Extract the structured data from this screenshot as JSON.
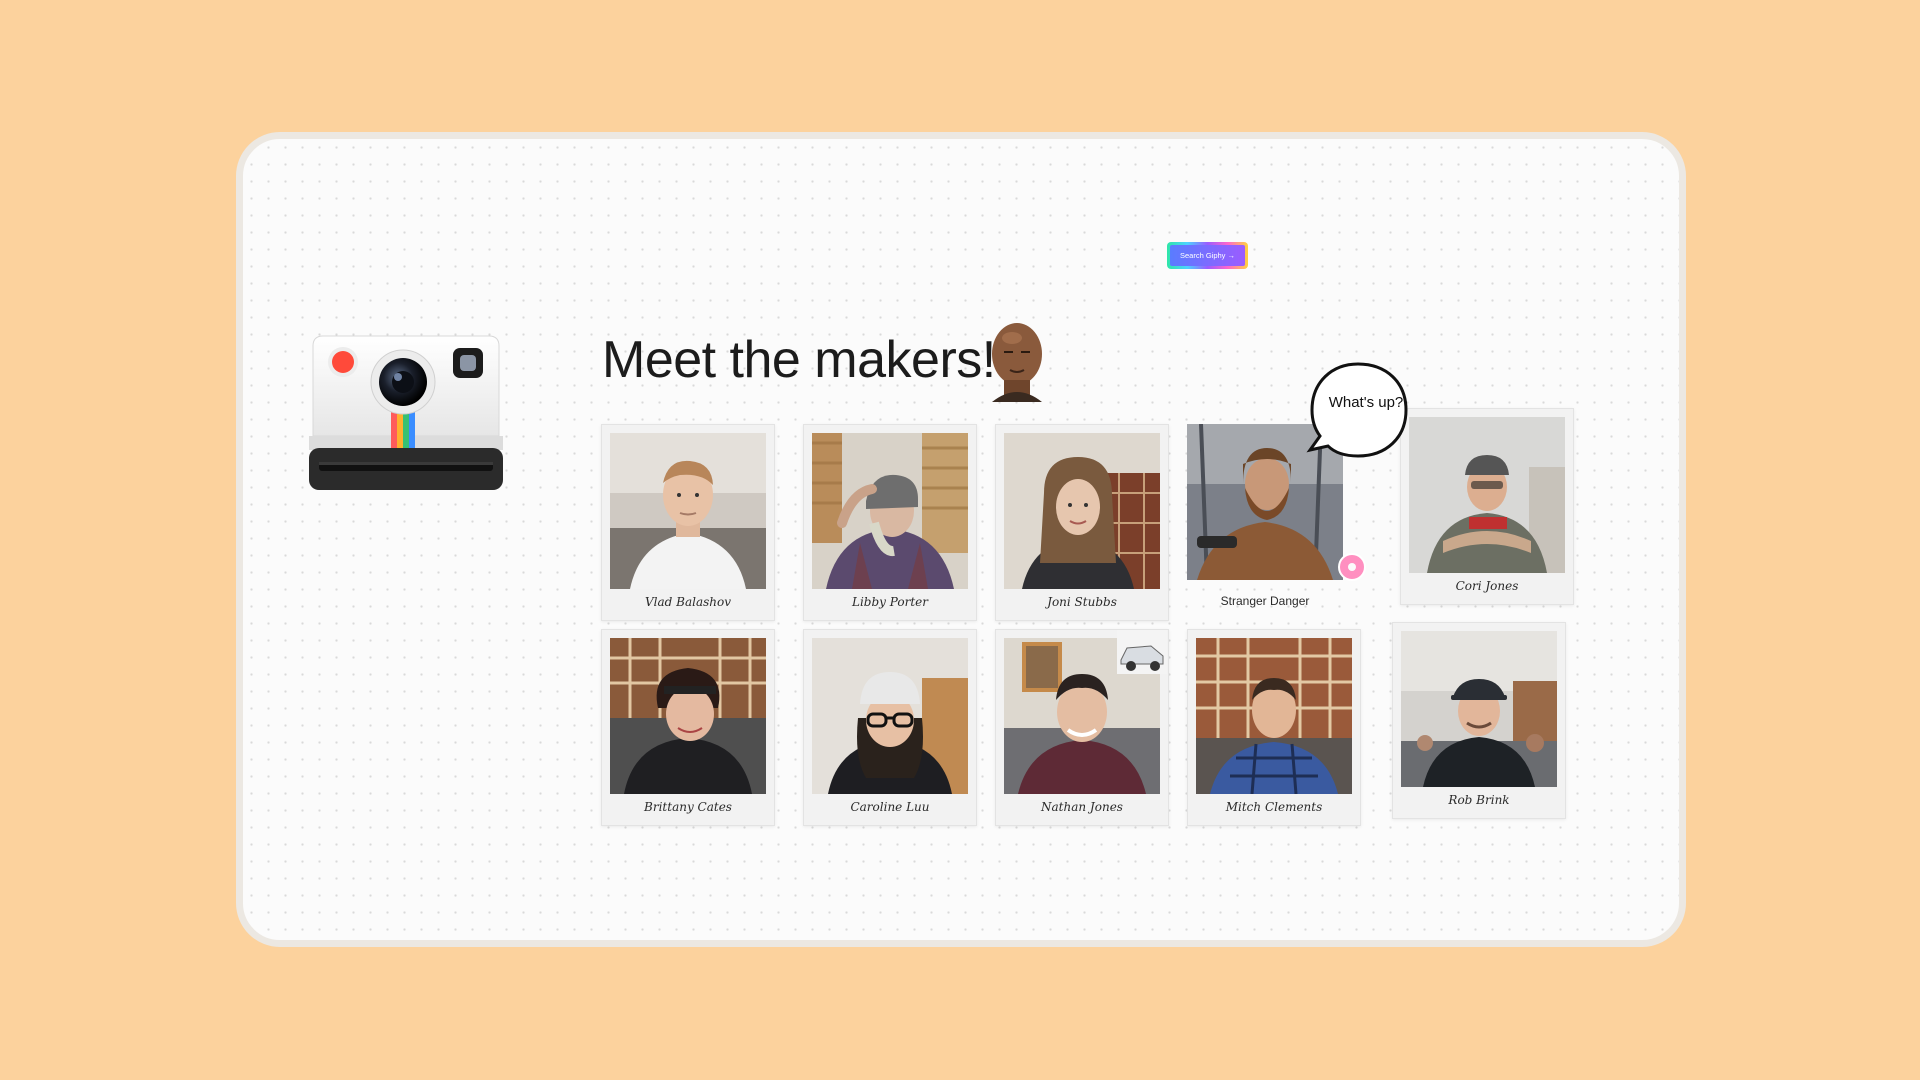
{
  "heading": "Meet the makers!",
  "giphy_button_label": "Search Giphy →",
  "speech_bubble": "What's up?",
  "makers": [
    {
      "name": "Vlad Balashov"
    },
    {
      "name": "Libby Porter"
    },
    {
      "name": "Joni Stubbs"
    },
    {
      "name": "Stranger Danger"
    },
    {
      "name": "Cori Jones"
    },
    {
      "name": "Brittany Cates"
    },
    {
      "name": "Caroline Luu"
    },
    {
      "name": "Nathan Jones"
    },
    {
      "name": "Mitch Clements"
    },
    {
      "name": "Rob Brink"
    }
  ],
  "colors": {
    "page_background": "#fcd29d",
    "board_background": "#fbfbfb",
    "card_background": "#f2f2f2"
  }
}
